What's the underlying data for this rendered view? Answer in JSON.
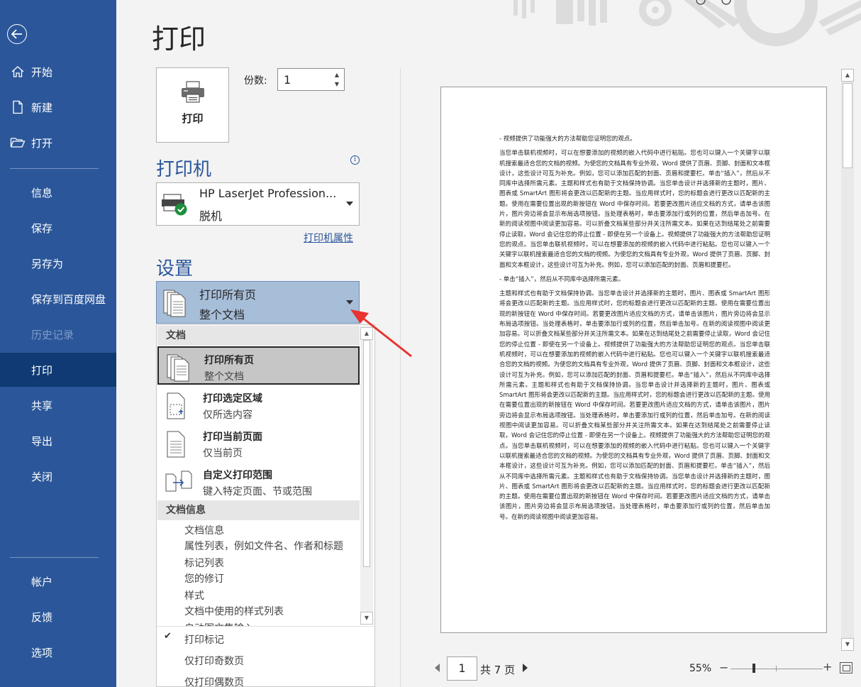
{
  "sidebar": {
    "items": [
      {
        "label": "开始"
      },
      {
        "label": "新建"
      },
      {
        "label": "打开"
      },
      {
        "label": "信息"
      },
      {
        "label": "保存"
      },
      {
        "label": "另存为"
      },
      {
        "label": "保存到百度网盘"
      },
      {
        "label": "历史记录"
      },
      {
        "label": "打印"
      },
      {
        "label": "共享"
      },
      {
        "label": "导出"
      },
      {
        "label": "关闭"
      },
      {
        "label": "帐户"
      },
      {
        "label": "反馈"
      },
      {
        "label": "选项"
      }
    ],
    "colors": {
      "background": "#2b579a",
      "active": "#0f3a73"
    }
  },
  "page_title": "打印",
  "print_button": {
    "label": "打印"
  },
  "copies": {
    "label": "份数:",
    "value": "1"
  },
  "printer": {
    "heading": "打印机",
    "name": "HP LaserJet Profession...",
    "status": "脱机",
    "properties_link": "打印机属性"
  },
  "settings": {
    "heading": "设置",
    "selected_title": "打印所有页",
    "selected_sub": "整个文档"
  },
  "dropdown": {
    "group1": "文档",
    "options": [
      {
        "title": "打印所有页",
        "sub": "整个文档"
      },
      {
        "title": "打印选定区域",
        "sub": "仅所选内容"
      },
      {
        "title": "打印当前页面",
        "sub": "仅当前页"
      },
      {
        "title": "自定义打印范围",
        "sub": "键入特定页面、节或范围"
      }
    ],
    "group2": "文档信息",
    "info_items": [
      "文档信息",
      "属性列表，例如文件名、作者和标题",
      "标记列表",
      "您的修订",
      "样式",
      "文档中使用的样式列表",
      "自动图文集输入"
    ],
    "lower_items": [
      "打印标记",
      "仅打印奇数页",
      "仅打印偶数页"
    ]
  },
  "preview": {
    "paragraphs": [
      "-   视频提供了功能强大的方法帮助您证明您的观点。",
      "当您单击联机视频时，可以在想要添加的视频的嵌入代码中进行粘贴。您也可以键入一个关键字以联机搜索最适合您的文档的视频。为使您的文档具有专业外观，Word 提供了页眉、页脚、封面和文本框设计，这些设计可互为补充。例如，您可以添加匹配的封面、页眉和提要栏。单击“插入”，然后从不同库中选择所需元素。主题和样式也有助于文档保持协调。当您单击设计并选择新的主题时，图片、图表或 SmartArt 图形将会更改以匹配新的主题。当应用样式时，您的标题会进行更改以匹配新的主题。使用在需要位置出现的新按钮在 Word 中保存时间。若要更改图片适应文档的方式，请单击该图片，图片旁边将会显示布局选项按钮。当处理表格时，单击要添加行或列的位置，然后单击加号。在新的阅读视图中阅读更加容易。可以折叠文档某些部分并关注所需文本。如果在达到结尾处之前需要停止读取，Word 会记住您的停止位置 - 即使在另一个设备上。视频提供了功能强大的方法帮助您证明您的观点。当您单击联机视频时，可以在想要添加的视频的嵌入代码中进行粘贴。您也可以键入一个关键字以联机搜索最适合您的文档的视频。为使您的文档具有专业外观，Word 提供了页眉、页脚、封面和文本框设计，这些设计可互为补充。例如，您可以添加匹配的封面、页眉和提要栏。",
      "-   单击“插入”，然后从不同库中选择所需元素。",
      "主题和样式也有助于文档保持协调。当您单击设计并选择新的主题时，图片、图表或 SmartArt 图形将会更改以匹配新的主题。当应用样式时，您的标题会进行更改以匹配新的主题。使用在需要位置出现的新按钮在 Word 中保存时间。若要更改图片适应文档的方式，请单击该图片，图片旁边将会显示布局选项按钮。当处理表格时，单击要添加行或列的位置，然后单击加号。在新的阅读视图中阅读更加容易。可以折叠文档某些部分并关注所需文本。如果在达到结尾处之前需要停止读取，Word 会记住您的停止位置 - 即使在另一个设备上。视频提供了功能强大的方法帮助您证明您的观点。当您单击联机视频时，可以在想要添加的视频的嵌入代码中进行粘贴。您也可以键入一个关键字以联机搜索最适合您的文档的视频。为使您的文档具有专业外观，Word 提供了页眉、页脚、封面和文本框设计，这些设计可互为补充。例如，您可以添加匹配的封面、页眉和提要栏。单击“插入”，然后从不同库中选择所需元素。主题和样式也有助于文档保持协调。当您单击设计并选择新的主题时，图片、图表或 SmartArt 图形将会更改以匹配新的主题。当应用样式时，您的标题会进行更改以匹配新的主题。使用在需要位置出现的新按钮在 Word 中保存时间。若要更改图片适应文档的方式，请单击该图片，图片旁边将会显示布局选项按钮。当处理表格时，单击要添加行或列的位置，然后单击加号。在新的阅读视图中阅读更加容易。可以折叠文档某些部分并关注所需文本。如果在达到结尾处之前需要停止读取，Word 会记住您的停止位置 - 即使在另一个设备上。视频提供了功能强大的方法帮助您证明您的观点。当您单击联机视频时，可以在想要添加的视频的嵌入代码中进行粘贴。您也可以键入一个关键字以联机搜索最适合您的文档的视频。为使您的文档具有专业外观，Word 提供了页眉、页脚、封面和文本框设计，这些设计可互为补充。例如，您可以添加匹配的封面、页眉和提要栏。单击“插入”，然后从不同库中选择所需元素。主题和样式也有助于文档保持协调。当您单击设计并选择新的主题时，图片、图表或 SmartArt 图形将会更改以匹配新的主题。当应用样式时，您的标题会进行更改以匹配新的主题。使用在需要位置出现的新按钮在 Word 中保存时间。若要更改图片适应文档的方式，请单击该图片，图片旁边将会显示布局选项按钮。当处理表格时，单击要添加行或列的位置，然后单击加号。在新的阅读视图中阅读更加容易。"
    ]
  },
  "pager": {
    "current": "1",
    "total": "共 7 页"
  },
  "zoom": {
    "percent": "55%",
    "minus": "−",
    "plus": "+",
    "level": 0.55
  },
  "icons": [
    "back-arrow-icon",
    "home-icon",
    "new-document-icon",
    "open-folder-icon",
    "printer-icon",
    "info-icon",
    "printer-online-icon",
    "pages-icon",
    "selection-icon",
    "single-page-icon",
    "custom-range-icon",
    "checkmark-icon",
    "chevron-down-icon",
    "fit-page-icon"
  ],
  "colors": {
    "accent": "#2b579a",
    "annotation_arrow": "#e8332f"
  }
}
